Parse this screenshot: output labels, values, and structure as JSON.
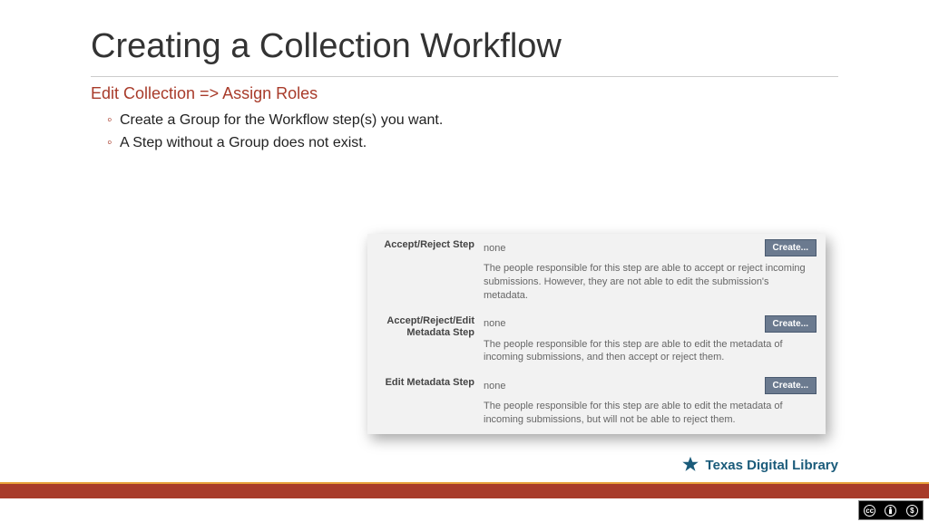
{
  "title": "Creating a Collection Workflow",
  "breadcrumb": "Edit Collection => Assign Roles",
  "bullets": [
    "Create a Group for the Workflow step(s) you want.",
    "A Step without a Group does not exist."
  ],
  "steps": [
    {
      "label": "Accept/Reject Step",
      "value": "none",
      "button": "Create...",
      "desc": "The people responsible for this step are able to accept or reject incoming submissions. However, they are not able to edit the submission's metadata."
    },
    {
      "label": "Accept/Reject/Edit Metadata Step",
      "value": "none",
      "button": "Create...",
      "desc": "The people responsible for this step are able to edit the metadata of incoming submissions, and then accept or reject them."
    },
    {
      "label": "Edit Metadata Step",
      "value": "none",
      "button": "Create...",
      "desc": "The people responsible for this step are able to edit the metadata of incoming submissions, but will not be able to reject them."
    }
  ],
  "logo_text": "Texas Digital Library",
  "cc": {
    "by": "BY",
    "nc": "NC"
  }
}
